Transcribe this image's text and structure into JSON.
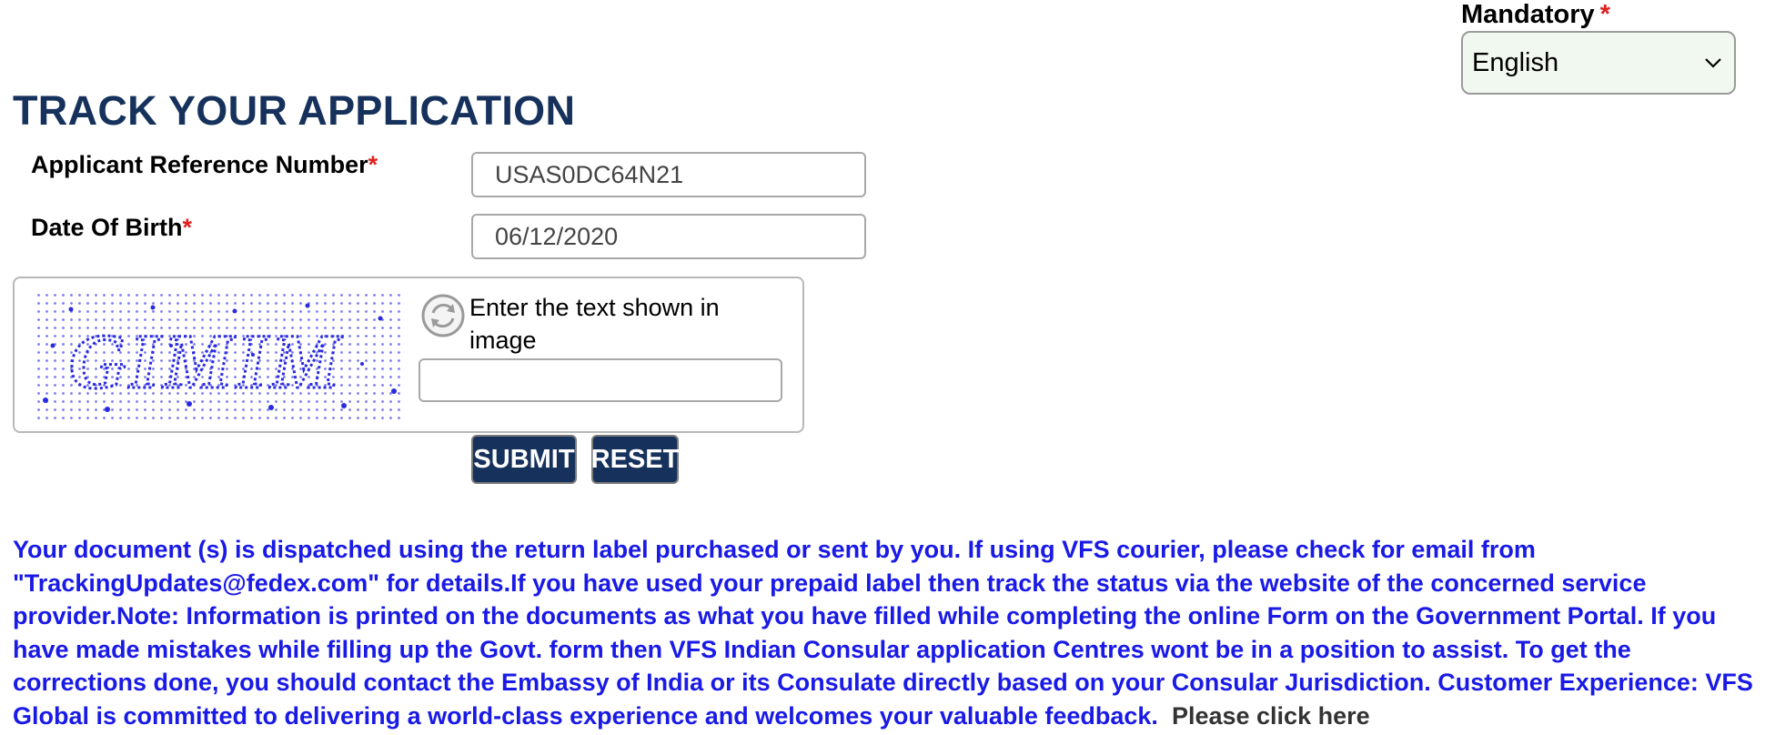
{
  "language": {
    "mandatory_label": "Mandatory",
    "required_marker": "*",
    "selected": "English"
  },
  "page": {
    "title": "TRACK YOUR APPLICATION"
  },
  "form": {
    "required_marker": "*",
    "reference_number": {
      "label": "Applicant Reference Number",
      "value": "USAS0DC64N21"
    },
    "date_of_birth": {
      "label": "Date Of Birth",
      "value": "06/12/2020"
    },
    "captcha": {
      "image_text": "GIMIM",
      "prompt": "Enter the text shown in image",
      "value": ""
    },
    "buttons": {
      "submit": "SUBMIT",
      "reset": "RESET"
    }
  },
  "notice": {
    "text": "Your document (s) is dispatched using the return label purchased or sent by you. If using VFS courier, please check for email from \"TrackingUpdates@fedex.com\" for details.If you have used your prepaid label then track the status via the website of the concerned service provider.Note: Information is printed on the documents as what you have filled while completing the online Form on the Government Portal. If you have made mistakes while filling up the Govt. form then VFS Indian Consular application Centres wont be in a position to assist. To get the corrections done, you should contact the Embassy of India or its Consulate directly based on your Consular Jurisdiction. Customer Experience: VFS Global is committed to delivering a world-class experience and welcomes your valuable feedback.",
    "link_prefix": "Please click",
    "link_label": "here"
  },
  "colors": {
    "title": "#16325c",
    "button_bg": "#16325c",
    "notice_text": "#1a1ae6",
    "required": "#e02020",
    "select_bg": "#f1f8ef"
  },
  "icons": {
    "refresh": "refresh-icon",
    "dropdown": "chevron-down-icon"
  }
}
